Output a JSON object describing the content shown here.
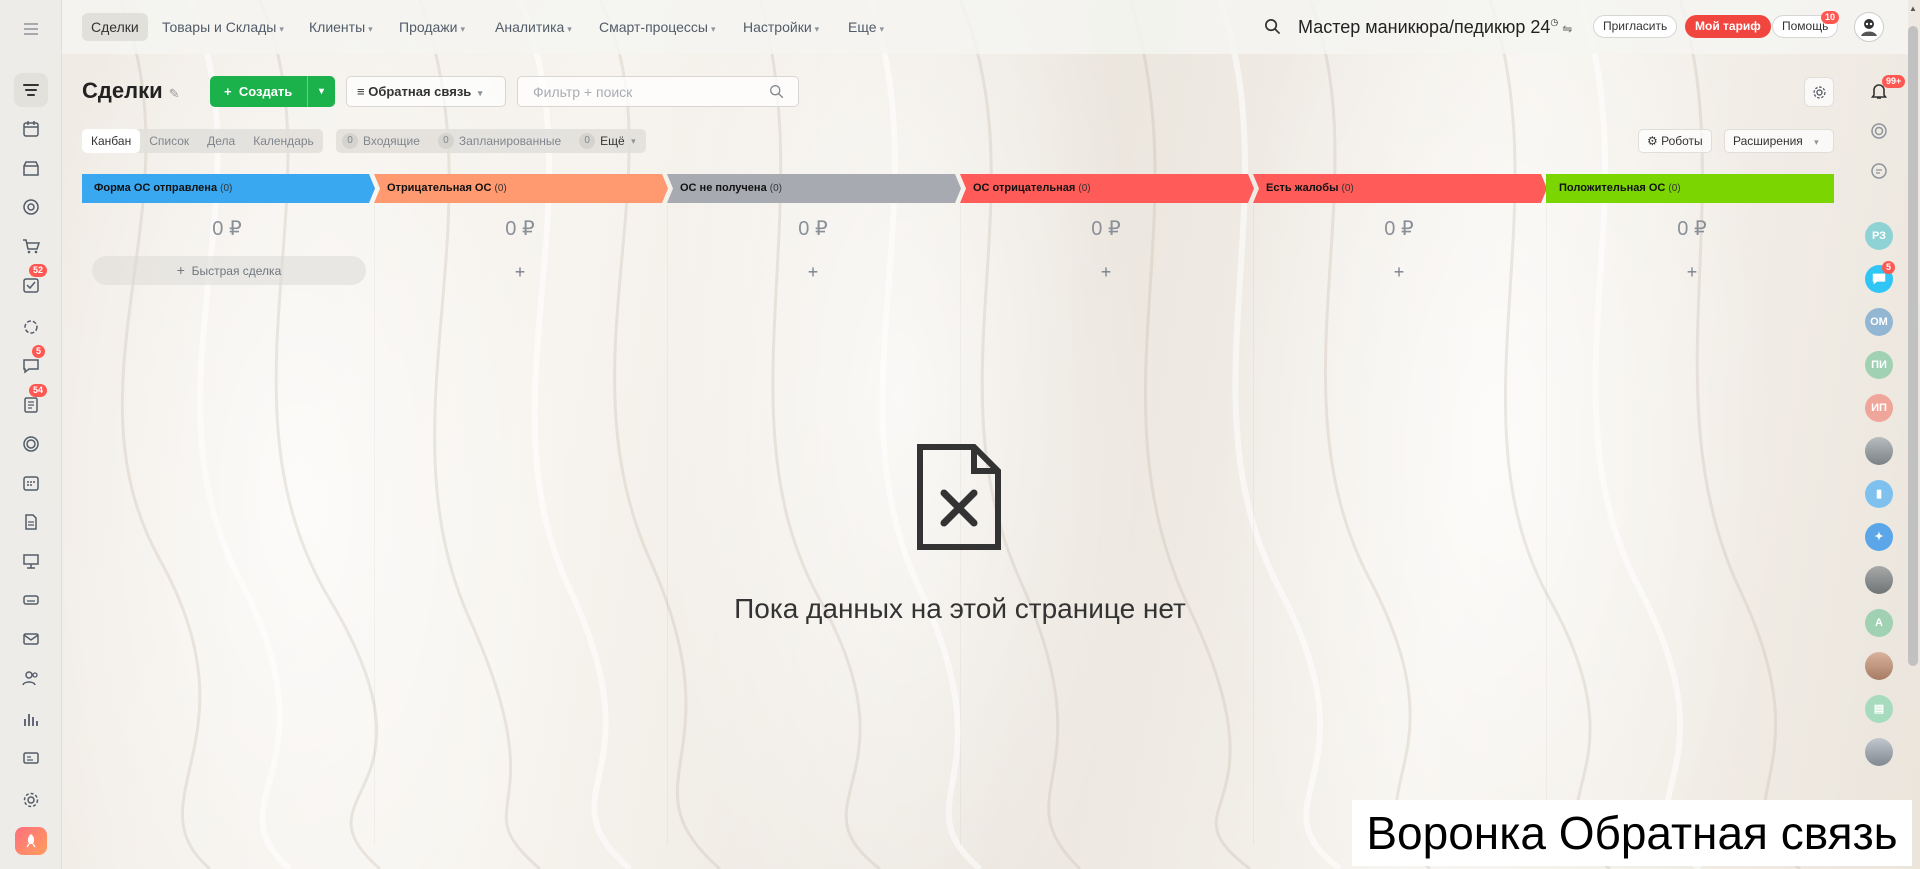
{
  "app": {
    "portal_name": "Мастер маникюра/педикюр 24",
    "page_title": "Сделки"
  },
  "topnav": {
    "items": [
      {
        "label": "Сделки",
        "active": true
      },
      {
        "label": "Товары и Склады"
      },
      {
        "label": "Клиенты"
      },
      {
        "label": "Продажи"
      },
      {
        "label": "Аналитика"
      },
      {
        "label": "Смарт-процессы"
      },
      {
        "label": "Настройки"
      },
      {
        "label": "Еще"
      }
    ],
    "invite_label": "Пригласить",
    "tariff_label": "Мой тариф",
    "help_label": "Помощь",
    "help_badge": "10"
  },
  "sidebar": {
    "badges": {
      "tasks": "52",
      "chats": "5",
      "docs": "54"
    }
  },
  "toolbar": {
    "create_label": "Создать",
    "funnel_label": "Обратная связь",
    "search_placeholder": "Фильтр + поиск",
    "robots_label": "Роботы",
    "extensions_label": "Расширения",
    "notifications_badge": "99+"
  },
  "view_tabs": [
    "Канбан",
    "Список",
    "Дела",
    "Календарь"
  ],
  "counters": [
    {
      "count": "0",
      "label": "Входящие"
    },
    {
      "count": "0",
      "label": "Запланированные"
    },
    {
      "count": "0",
      "label": "Ещё"
    }
  ],
  "kanban": {
    "quick_deal_label": "Быстрая сделка",
    "add_symbol": "+",
    "columns": [
      {
        "title": "Форма ОС отправлена",
        "count": "(0)",
        "sum": "0 ₽",
        "color": "#3aa8f0"
      },
      {
        "title": "Отрицательная ОС",
        "count": "(0)",
        "sum": "0 ₽",
        "color": "#ff9970"
      },
      {
        "title": "ОС не получена",
        "count": "(0)",
        "sum": "0 ₽",
        "color": "#a7abb1"
      },
      {
        "title": "ОС отрицательная",
        "count": "(0)",
        "sum": "0 ₽",
        "color": "#ff5b58"
      },
      {
        "title": "Есть жалобы",
        "count": "(0)",
        "sum": "0 ₽",
        "color": "#ff5b58"
      },
      {
        "title": "Положительная ОС",
        "count": "(0)",
        "sum": "0 ₽",
        "color": "#7bd500"
      }
    ]
  },
  "empty_state": {
    "text": "Пока данных на этой странице нет"
  },
  "rail": {
    "chat_badge": "5",
    "avatars": [
      {
        "initials": "РЗ",
        "color": "#8fd2d6"
      },
      {
        "initials": "",
        "color": "#2fc6f6"
      },
      {
        "initials": "ОМ",
        "color": "#93b7d3"
      },
      {
        "initials": "ПИ",
        "color": "#9fd1b2"
      },
      {
        "initials": "ИП",
        "color": "#f0a59a"
      },
      {
        "initials": "",
        "color": "#a0a5a8"
      },
      {
        "initials": "",
        "color": "#7ec1ee"
      },
      {
        "initials": "",
        "color": "#5aa6e8"
      },
      {
        "initials": "",
        "color": "#8e9396"
      },
      {
        "initials": "А",
        "color": "#9fd1b2"
      },
      {
        "initials": "",
        "color": "#c79a84"
      },
      {
        "initials": "",
        "color": "#a6dcbd"
      },
      {
        "initials": "",
        "color": "#9ea8b3"
      }
    ]
  },
  "caption": "Воронка Обратная связь"
}
